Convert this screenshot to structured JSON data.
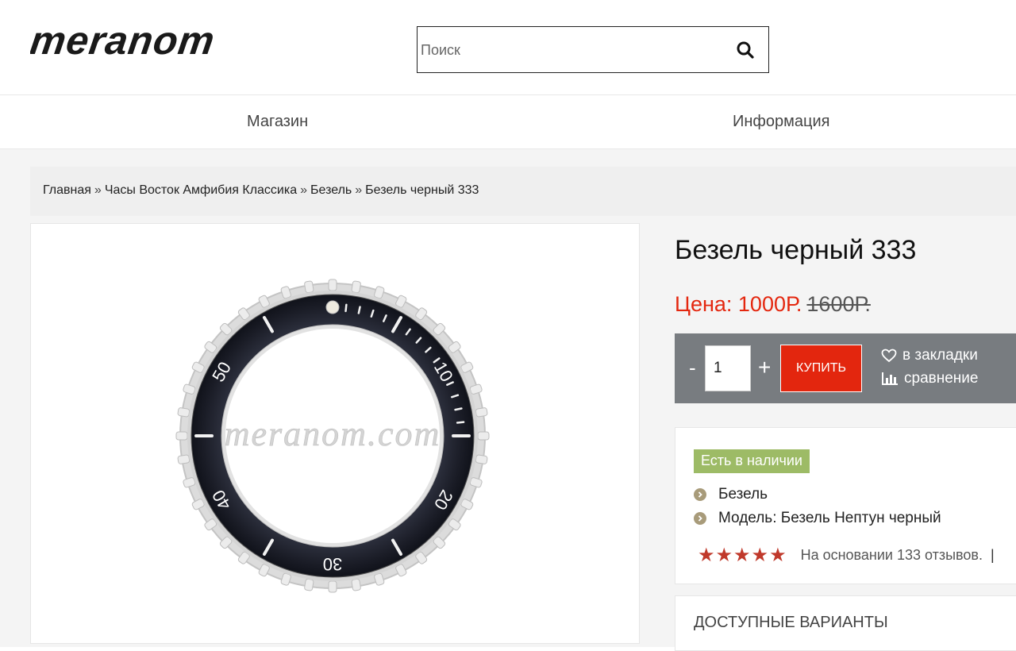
{
  "header": {
    "logo_text": "meranom",
    "search": {
      "placeholder": "Поиск",
      "value": ""
    }
  },
  "nav": {
    "items": [
      {
        "label": "Магазин"
      },
      {
        "label": "Информация"
      }
    ]
  },
  "breadcrumb": {
    "items": [
      {
        "label": "Главная"
      },
      {
        "label": "Часы Восток Амфибия Классика"
      },
      {
        "label": "Безель"
      },
      {
        "label": "Безель черный 333"
      }
    ],
    "separator": "»"
  },
  "product": {
    "title": "Безель черный 333",
    "price_label": "Цена: 1000Р.",
    "old_price": "1600Р.",
    "quantity": "1",
    "minus_label": "-",
    "plus_label": "+",
    "buy_label": "КУПИТЬ",
    "bookmark_label": "в закладки",
    "compare_label": "сравнение",
    "stock_badge": "Есть в наличии",
    "specs": [
      {
        "text": "Безель"
      },
      {
        "text": "Модель: Безель Нептун черный"
      }
    ],
    "rating": {
      "stars": 5,
      "stars_text": "★★★★★",
      "reviews_text": "На основании 133 отзывов.",
      "pipe": "|"
    },
    "variants_title": "ДОСТУПНЫЕ ВАРИАНТЫ",
    "image": {
      "watermark": "meranom.com",
      "markers": [
        "10",
        "20",
        "30",
        "40",
        "50"
      ]
    }
  },
  "colors": {
    "accent_red": "#e3260e",
    "price_red": "#e4270f",
    "buy_bar": "#787c80",
    "stock_green": "#9dbb66",
    "star_red": "#c0392b",
    "bullet": "#a89b7a"
  },
  "icons": [
    "search-icon",
    "heart-icon",
    "bar-chart-icon",
    "chevron-right-icon",
    "star-icon"
  ]
}
